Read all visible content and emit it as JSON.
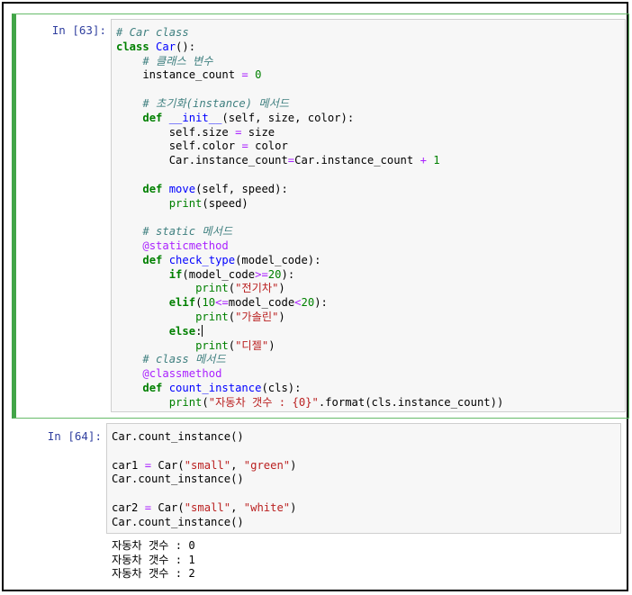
{
  "cells": [
    {
      "prompt": "In [63]:",
      "selected": true,
      "lines": [
        [
          {
            "t": "# Car class",
            "c": "cm"
          }
        ],
        [
          {
            "t": "class",
            "c": "kw"
          },
          {
            "t": " "
          },
          {
            "t": "Car",
            "c": "nf"
          },
          {
            "t": "():"
          }
        ],
        [
          {
            "t": "    "
          },
          {
            "t": "# 클래스 변수",
            "c": "cm"
          }
        ],
        [
          {
            "t": "    instance_count "
          },
          {
            "t": "=",
            "c": "op"
          },
          {
            "t": " "
          },
          {
            "t": "0",
            "c": "num"
          }
        ],
        [],
        [
          {
            "t": "    "
          },
          {
            "t": "# 초기화(instance) 메서드",
            "c": "cm"
          }
        ],
        [
          {
            "t": "    "
          },
          {
            "t": "def",
            "c": "kw"
          },
          {
            "t": " "
          },
          {
            "t": "__init__",
            "c": "nf"
          },
          {
            "t": "(self, size, color):"
          }
        ],
        [
          {
            "t": "        self"
          },
          {
            "t": "."
          },
          {
            "t": "size "
          },
          {
            "t": "=",
            "c": "op"
          },
          {
            "t": " size"
          }
        ],
        [
          {
            "t": "        self"
          },
          {
            "t": "."
          },
          {
            "t": "color "
          },
          {
            "t": "=",
            "c": "op"
          },
          {
            "t": " color"
          }
        ],
        [
          {
            "t": "        Car"
          },
          {
            "t": "."
          },
          {
            "t": "instance_count"
          },
          {
            "t": "=",
            "c": "op"
          },
          {
            "t": "Car.instance_count "
          },
          {
            "t": "+",
            "c": "op"
          },
          {
            "t": " "
          },
          {
            "t": "1",
            "c": "num"
          }
        ],
        [],
        [
          {
            "t": "    "
          },
          {
            "t": "def",
            "c": "kw"
          },
          {
            "t": " "
          },
          {
            "t": "move",
            "c": "nf"
          },
          {
            "t": "(self, speed):"
          }
        ],
        [
          {
            "t": "        "
          },
          {
            "t": "print",
            "c": "nb"
          },
          {
            "t": "(speed)"
          }
        ],
        [],
        [
          {
            "t": "    "
          },
          {
            "t": "# static 메서드",
            "c": "cm"
          }
        ],
        [
          {
            "t": "    "
          },
          {
            "t": "@staticmethod",
            "c": "dec"
          }
        ],
        [
          {
            "t": "    "
          },
          {
            "t": "def",
            "c": "kw"
          },
          {
            "t": " "
          },
          {
            "t": "check_type",
            "c": "nf"
          },
          {
            "t": "(model_code):"
          }
        ],
        [
          {
            "t": "        "
          },
          {
            "t": "if",
            "c": "kw"
          },
          {
            "t": "(model_code"
          },
          {
            "t": ">=",
            "c": "op"
          },
          {
            "t": "20",
            "c": "num"
          },
          {
            "t": "):"
          }
        ],
        [
          {
            "t": "            "
          },
          {
            "t": "print",
            "c": "nb"
          },
          {
            "t": "("
          },
          {
            "t": "\"전기차\"",
            "c": "st"
          },
          {
            "t": ")"
          }
        ],
        [
          {
            "t": "        "
          },
          {
            "t": "elif",
            "c": "kw"
          },
          {
            "t": "("
          },
          {
            "t": "10",
            "c": "num"
          },
          {
            "t": "<=",
            "c": "op"
          },
          {
            "t": "model_code"
          },
          {
            "t": "<",
            "c": "op"
          },
          {
            "t": "20",
            "c": "num"
          },
          {
            "t": "):"
          }
        ],
        [
          {
            "t": "            "
          },
          {
            "t": "print",
            "c": "nb"
          },
          {
            "t": "("
          },
          {
            "t": "\"가솔린\"",
            "c": "st"
          },
          {
            "t": ")"
          }
        ],
        [
          {
            "t": "        "
          },
          {
            "t": "else",
            "c": "kw"
          },
          {
            "t": ":"
          },
          {
            "t": "",
            "c": "cursor"
          }
        ],
        [
          {
            "t": "            "
          },
          {
            "t": "print",
            "c": "nb"
          },
          {
            "t": "("
          },
          {
            "t": "\"디젤\"",
            "c": "st"
          },
          {
            "t": ")"
          }
        ],
        [
          {
            "t": "    "
          },
          {
            "t": "# class 메서드",
            "c": "cm"
          }
        ],
        [
          {
            "t": "    "
          },
          {
            "t": "@classmethod",
            "c": "dec"
          }
        ],
        [
          {
            "t": "    "
          },
          {
            "t": "def",
            "c": "kw"
          },
          {
            "t": " "
          },
          {
            "t": "count_instance",
            "c": "nf"
          },
          {
            "t": "(cls):"
          }
        ],
        [
          {
            "t": "        "
          },
          {
            "t": "print",
            "c": "nb"
          },
          {
            "t": "("
          },
          {
            "t": "\"자동차 갯수 : {0}\"",
            "c": "st"
          },
          {
            "t": ".format(cls.instance_count))"
          }
        ]
      ]
    },
    {
      "prompt": "In [64]:",
      "selected": false,
      "lines": [
        [
          {
            "t": "Car.count_instance()"
          }
        ],
        [],
        [
          {
            "t": "car1 "
          },
          {
            "t": "=",
            "c": "op"
          },
          {
            "t": " Car("
          },
          {
            "t": "\"small\"",
            "c": "st"
          },
          {
            "t": ", "
          },
          {
            "t": "\"green\"",
            "c": "st"
          },
          {
            "t": ")"
          }
        ],
        [
          {
            "t": "Car.count_instance()"
          }
        ],
        [],
        [
          {
            "t": "car2 "
          },
          {
            "t": "=",
            "c": "op"
          },
          {
            "t": " Car("
          },
          {
            "t": "\"small\"",
            "c": "st"
          },
          {
            "t": ", "
          },
          {
            "t": "\"white\"",
            "c": "st"
          },
          {
            "t": ")"
          }
        ],
        [
          {
            "t": "Car.count_instance()"
          }
        ]
      ],
      "output": [
        "자동차 갯수 : 0",
        "자동차 갯수 : 1",
        "자동차 갯수 : 2"
      ]
    }
  ]
}
